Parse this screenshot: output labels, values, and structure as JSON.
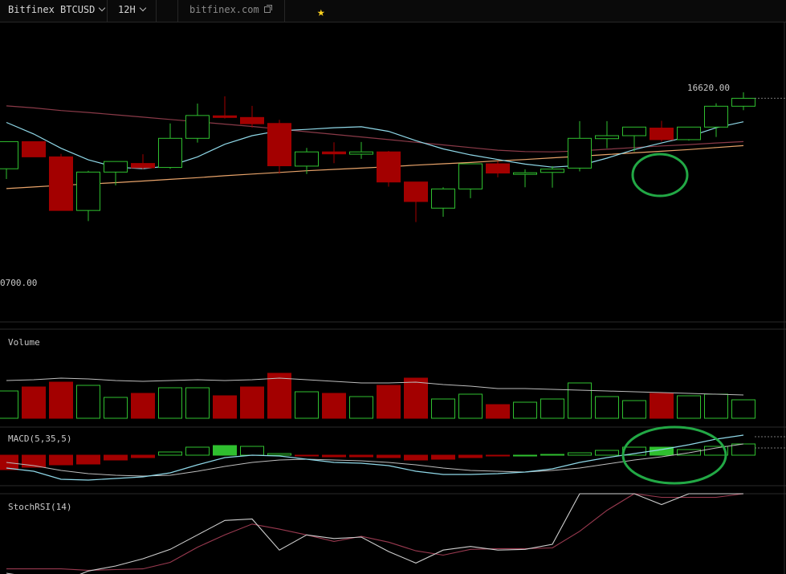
{
  "toolbar": {
    "symbol": "Bitfinex BTCUSD",
    "interval": "12H",
    "site": "bitfinex.com"
  },
  "colors": {
    "up": "#2fbf2f",
    "down": "#a30000",
    "sma_fast": "#8fd8e8",
    "sma_mid": "#8a3a48",
    "sma_slow": "#e8a36a",
    "annotation": "#22a845"
  },
  "chart_data": [
    {
      "type": "candlestick",
      "panel": "price",
      "price_labels": [
        "16620.00",
        "0700.00"
      ],
      "candles": [
        {
          "o": 14140,
          "h": 14800,
          "l": 13830,
          "c": 14960
        },
        {
          "o": 14960,
          "h": 14970,
          "l": 14520,
          "c": 14500
        },
        {
          "o": 14500,
          "h": 14590,
          "l": 12880,
          "c": 12880
        },
        {
          "o": 12880,
          "h": 14080,
          "l": 12560,
          "c": 14040
        },
        {
          "o": 14040,
          "h": 14360,
          "l": 13640,
          "c": 14360
        },
        {
          "o": 14300,
          "h": 14580,
          "l": 14120,
          "c": 14170
        },
        {
          "o": 14180,
          "h": 15510,
          "l": 14140,
          "c": 15060
        },
        {
          "o": 15060,
          "h": 16110,
          "l": 14930,
          "c": 15750
        },
        {
          "o": 15740,
          "h": 16330,
          "l": 15660,
          "c": 15690
        },
        {
          "o": 15690,
          "h": 16040,
          "l": 15380,
          "c": 15500
        },
        {
          "o": 15510,
          "h": 15620,
          "l": 13990,
          "c": 14230
        },
        {
          "o": 14220,
          "h": 14770,
          "l": 13980,
          "c": 14650
        },
        {
          "o": 14650,
          "h": 14940,
          "l": 14310,
          "c": 14590
        },
        {
          "o": 14580,
          "h": 14950,
          "l": 14440,
          "c": 14650
        },
        {
          "o": 14650,
          "h": 14680,
          "l": 13600,
          "c": 13740
        },
        {
          "o": 13740,
          "h": 13740,
          "l": 12530,
          "c": 13150
        },
        {
          "o": 12950,
          "h": 13580,
          "l": 12690,
          "c": 13530
        },
        {
          "o": 13530,
          "h": 14290,
          "l": 13250,
          "c": 14290
        },
        {
          "o": 14290,
          "h": 14370,
          "l": 13880,
          "c": 14010
        },
        {
          "o": 13980,
          "h": 14120,
          "l": 13580,
          "c": 14020
        },
        {
          "o": 14030,
          "h": 14220,
          "l": 13570,
          "c": 14130
        },
        {
          "o": 14160,
          "h": 15580,
          "l": 14060,
          "c": 15060
        },
        {
          "o": 15050,
          "h": 15580,
          "l": 14760,
          "c": 15140
        },
        {
          "o": 15140,
          "h": 15400,
          "l": 14660,
          "c": 15400
        },
        {
          "o": 15370,
          "h": 15590,
          "l": 14960,
          "c": 15020
        },
        {
          "o": 15020,
          "h": 15400,
          "l": 14990,
          "c": 15400
        },
        {
          "o": 15400,
          "h": 16120,
          "l": 15100,
          "c": 16030
        },
        {
          "o": 16030,
          "h": 16450,
          "l": 15910,
          "c": 16270
        }
      ],
      "sma_fast": [
        15540,
        15190,
        14760,
        14410,
        14190,
        14140,
        14230,
        14500,
        14880,
        15140,
        15290,
        15330,
        15380,
        15410,
        15270,
        14990,
        14740,
        14560,
        14420,
        14280,
        14190,
        14240,
        14460,
        14720,
        14920,
        15110,
        15380,
        15560
      ],
      "sma_mid": [
        16040,
        15980,
        15900,
        15840,
        15770,
        15700,
        15630,
        15560,
        15490,
        15420,
        15340,
        15260,
        15180,
        15100,
        15020,
        14940,
        14860,
        14780,
        14700,
        14660,
        14650,
        14680,
        14730,
        14780,
        14830,
        14870,
        14920,
        14960
      ],
      "sma_slow": [
        13540,
        13590,
        13640,
        13680,
        13720,
        13770,
        13820,
        13870,
        13930,
        13980,
        14030,
        14080,
        14120,
        14160,
        14200,
        14250,
        14290,
        14330,
        14380,
        14420,
        14470,
        14520,
        14570,
        14620,
        14670,
        14720,
        14780,
        14840
      ]
    },
    {
      "type": "bar",
      "panel": "volume",
      "title": "Volume",
      "values": [
        34,
        39,
        45,
        41,
        26,
        31,
        38,
        38,
        28,
        39,
        56,
        33,
        31,
        27,
        41,
        50,
        24,
        30,
        17,
        20,
        24,
        44,
        27,
        22,
        31,
        28,
        30,
        23
      ],
      "ma": [
        47,
        48,
        50,
        49,
        47,
        46,
        47,
        48,
        47,
        48,
        50,
        48,
        46,
        44,
        44,
        45,
        42,
        40,
        37,
        37,
        36,
        35,
        34,
        33,
        32,
        31,
        30,
        29
      ]
    },
    {
      "type": "bar",
      "panel": "macd",
      "title": "MACD(5,35,5)",
      "histogram": [
        -18,
        -15,
        -12,
        -11,
        -6,
        -3,
        4,
        10,
        12,
        11,
        2,
        -1,
        -2,
        -2,
        -3,
        -6,
        -5,
        -3,
        -1,
        0,
        1,
        3,
        6,
        10,
        10,
        7,
        11,
        14
      ],
      "macd": [
        -16,
        -20,
        -30,
        -31,
        -29,
        -27,
        -22,
        -12,
        -3,
        0,
        -1,
        -5,
        -9,
        -10,
        -13,
        -20,
        -24,
        -24,
        -23,
        -21,
        -17,
        -9,
        -3,
        2,
        7,
        13,
        20,
        25
      ],
      "signal": [
        -9,
        -13,
        -19,
        -23,
        -25,
        -26,
        -25,
        -20,
        -14,
        -9,
        -6,
        -5,
        -6,
        -7,
        -9,
        -12,
        -16,
        -19,
        -20,
        -21,
        -19,
        -16,
        -11,
        -6,
        -2,
        3,
        9,
        14
      ]
    },
    {
      "type": "line",
      "panel": "stochrsi",
      "title": "StochRSI(14)",
      "k": [
        -10,
        -16,
        -22,
        -7,
        0,
        10,
        23,
        43,
        63,
        65,
        22,
        43,
        38,
        40,
        20,
        4,
        22,
        27,
        22,
        23,
        30,
        100,
        100,
        100,
        85,
        100,
        100,
        100
      ],
      "d": [
        -4,
        -4,
        -4,
        -6,
        -5,
        -4,
        5,
        26,
        43,
        58,
        51,
        43,
        34,
        41,
        33,
        21,
        15,
        23,
        24,
        24,
        25,
        48,
        77,
        100,
        95,
        95,
        95,
        100
      ]
    }
  ]
}
